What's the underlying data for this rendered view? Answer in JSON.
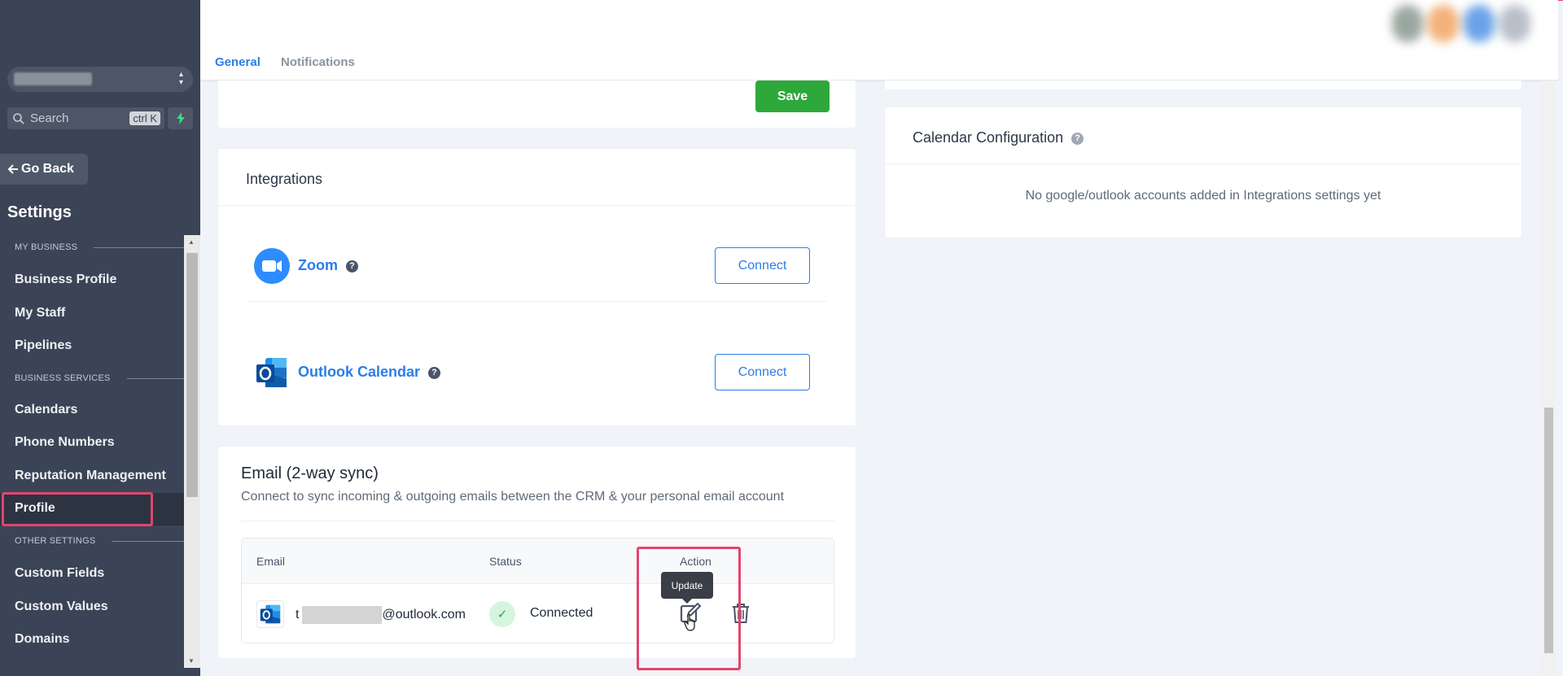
{
  "sidebar": {
    "search_placeholder": "Search",
    "search_shortcut": "ctrl K",
    "go_back": "Go Back",
    "title": "Settings",
    "sections": {
      "my_business": "MY BUSINESS",
      "business_services": "BUSINESS SERVICES",
      "other_settings": "OTHER SETTINGS"
    },
    "items": {
      "business_profile": "Business Profile",
      "my_staff": "My Staff",
      "pipelines": "Pipelines",
      "calendars": "Calendars",
      "phone_numbers": "Phone Numbers",
      "reputation_management": "Reputation Management",
      "profile": "Profile",
      "custom_fields": "Custom Fields",
      "custom_values": "Custom Values",
      "domains": "Domains"
    },
    "active_item": "Profile"
  },
  "header": {
    "tabs": [
      "General",
      "Notifications"
    ],
    "active_tab": "General"
  },
  "general": {
    "save_label": "Save"
  },
  "integrations": {
    "title": "Integrations",
    "items": [
      {
        "name": "Zoom",
        "button": "Connect",
        "icon": "zoom-icon"
      },
      {
        "name": "Outlook Calendar",
        "button": "Connect",
        "icon": "outlook-icon"
      }
    ]
  },
  "email_sync": {
    "title": "Email (2-way sync)",
    "subtitle": "Connect to sync incoming & outgoing emails between the CRM & your personal email account",
    "columns": [
      "Email",
      "Status",
      "Action"
    ],
    "rows": [
      {
        "email_prefix": "t",
        "email_suffix": "@outlook.com",
        "status": "Connected"
      }
    ],
    "tooltip": "Update"
  },
  "calendar_config": {
    "title": "Calendar Configuration",
    "empty_message": "No google/outlook accounts added in Integrations settings yet"
  },
  "colors": {
    "sidebar_bg": "#3b4456",
    "accent_blue": "#2b7de9",
    "save_green": "#2ea83a",
    "highlight_pink": "#e0456e"
  }
}
